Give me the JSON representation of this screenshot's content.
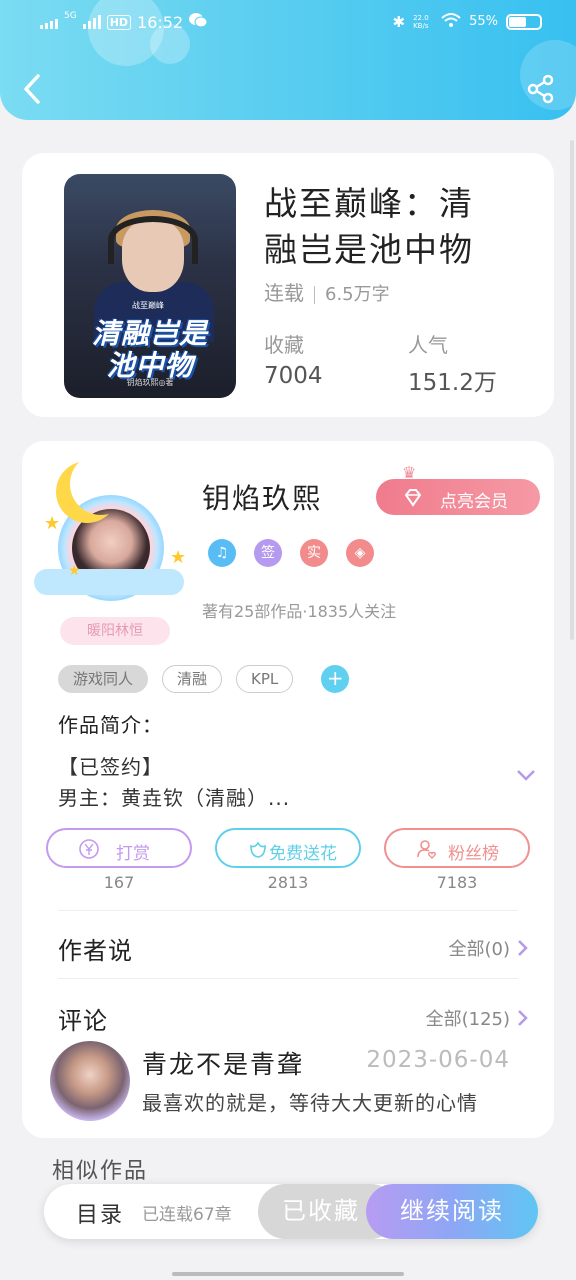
{
  "status_bar": {
    "network": "5G",
    "hd": "HD",
    "time": "16:52",
    "speed": "22.0 KB/s",
    "battery": "55%",
    "battery_level": 0.55
  },
  "book": {
    "title": "战至巅峰：清融岂是池中物",
    "status": "连载",
    "words": "6.5万字",
    "favorites_label": "收藏",
    "favorites": "7004",
    "popularity_label": "人气",
    "popularity": "151.2万",
    "cover": {
      "tag": "战至巅峰",
      "line1": "清融岂是",
      "line2": "池中物",
      "author": "钥焰玖熙◎著"
    }
  },
  "author": {
    "name": "钥焰玖熙",
    "avatar_tag": "暖阳林恒",
    "vip_button": "点亮会员",
    "badges": [
      {
        "name": "music",
        "label": "♫",
        "color": "#58bdf4"
      },
      {
        "name": "signed",
        "label": "签",
        "color": "#b69af0"
      },
      {
        "name": "verified",
        "label": "实",
        "color": "#f28c8c"
      },
      {
        "name": "diamond",
        "label": "◈",
        "color": "#f28c8c"
      }
    ],
    "works_info": "著有25部作品·1835人关注"
  },
  "tags": [
    "游戏同人",
    "清融",
    "KPL"
  ],
  "intro": {
    "title": "作品简介：",
    "line1": "【已签约】",
    "line2": "男主：黄垚钦（清融）..."
  },
  "actions": [
    {
      "label": "打赏",
      "count": "167",
      "color": "#c39af0"
    },
    {
      "label": "免费送花",
      "count": "2813",
      "color": "#5fd0e8"
    },
    {
      "label": "粉丝榜",
      "count": "7183",
      "color": "#f09090"
    }
  ],
  "author_says": {
    "title": "作者说",
    "link": "全部(0)"
  },
  "comments": {
    "title": "评论",
    "link": "全部(125)",
    "items": [
      {
        "user": "青龙不是青聋",
        "date": "2023-06-04",
        "text": "最喜欢的就是，等待大大更新的心情"
      }
    ]
  },
  "similar": "相似作品",
  "bottom_bar": {
    "toc": "目录",
    "chapters": "已连载67章",
    "favorited": "已收藏",
    "continue": "继续阅读"
  },
  "colors": {
    "header_start": "#7bdcf2",
    "header_end": "#38c0f0",
    "vip": "#f07b8c",
    "accent": "#5fd0f0"
  }
}
